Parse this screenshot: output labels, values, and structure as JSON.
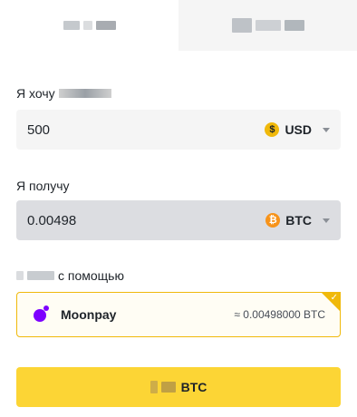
{
  "tabs": [
    {
      "label": "",
      "active": true
    },
    {
      "label": "",
      "active": false
    }
  ],
  "spend": {
    "label": "Я хочу",
    "value": "500",
    "currency": "USD",
    "currency_symbol": "$"
  },
  "receive": {
    "label": "Я получу",
    "value": "0.00498",
    "currency": "BTC",
    "currency_symbol": "₿"
  },
  "method": {
    "label": "с помощью",
    "provider_name": "Moonpay",
    "provider_quote": "≈ 0.00498000 BTC",
    "check_icon": "✓"
  },
  "button": {
    "label": "BTC"
  },
  "colors": {
    "accent": "#fcd535",
    "border_selected": "#f0b90b",
    "moonpay": "#7d00ff",
    "btc": "#f7931a"
  }
}
